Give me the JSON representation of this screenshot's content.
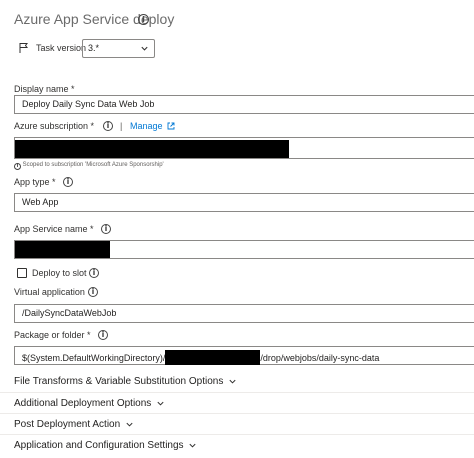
{
  "header": {
    "title": "Azure App Service deploy"
  },
  "task_version": {
    "label": "Task version",
    "selected": "3.*"
  },
  "display_name": {
    "label": "Display name *",
    "value": "Deploy Daily Sync Data Web Job"
  },
  "azure_subscription": {
    "label": "Azure subscription *",
    "separator": "|",
    "manage_label": "Manage",
    "scope_note": "Scoped to subscription 'Microsoft Azure Sponsorship'"
  },
  "app_type": {
    "label": "App type *",
    "value": "Web App"
  },
  "app_service_name": {
    "label": "App Service name *"
  },
  "deploy_to_slot": {
    "label": "Deploy to slot"
  },
  "virtual_application": {
    "label": "Virtual application",
    "value": "/DailySyncDataWebJob"
  },
  "package_or_folder": {
    "label": "Package or folder *",
    "value_prefix": "$(System.DefaultWorkingDirectory)/",
    "value_suffix": "/drop/webjobs/daily-sync-data"
  },
  "sections": [
    {
      "label": "File Transforms & Variable Substitution Options"
    },
    {
      "label": "Additional Deployment Options"
    },
    {
      "label": "Post Deployment Action"
    },
    {
      "label": "Application and Configuration Settings"
    }
  ]
}
